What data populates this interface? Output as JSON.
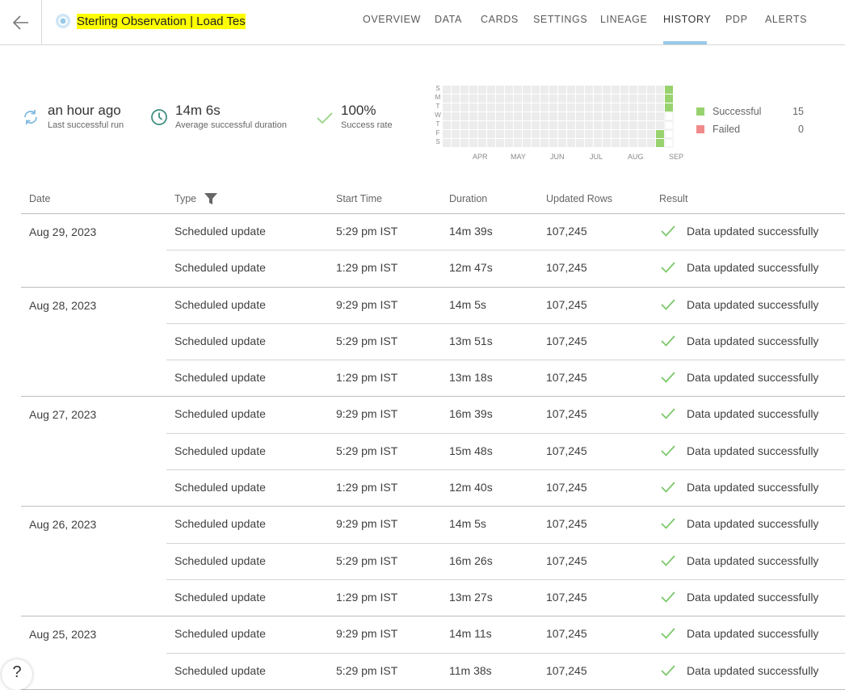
{
  "header": {
    "title": "Sterling Observation | Load Tes",
    "tabs": [
      "OVERVIEW",
      "DATA",
      "CARDS",
      "SETTINGS",
      "LINEAGE",
      "HISTORY",
      "PDP",
      "ALERTS"
    ],
    "active_tab": "HISTORY"
  },
  "stats": {
    "last_run": {
      "value": "an hour ago",
      "label": "Last successful run"
    },
    "avg_duration": {
      "value": "14m 6s",
      "label": "Average successful duration"
    },
    "success_rate": {
      "value": "100%",
      "label": "Success rate"
    }
  },
  "heatmap": {
    "days": [
      "S",
      "M",
      "T",
      "W",
      "T",
      "F",
      "S"
    ],
    "months": [
      "APR",
      "MAY",
      "JUN",
      "JUL",
      "AUG",
      "SEP"
    ],
    "legend": [
      {
        "name": "Successful",
        "count": "15",
        "color": "#98d26f"
      },
      {
        "name": "Failed",
        "count": "0",
        "color": "#f08a8a"
      }
    ]
  },
  "table": {
    "headers": {
      "date": "Date",
      "type": "Type",
      "start": "Start Time",
      "duration": "Duration",
      "rows": "Updated Rows",
      "result": "Result"
    },
    "groups": [
      {
        "date": "Aug 29, 2023",
        "rows": [
          {
            "type": "Scheduled update",
            "start": "5:29 pm IST",
            "duration": "14m 39s",
            "rows": "107,245",
            "result": "Data updated successfully"
          },
          {
            "type": "Scheduled update",
            "start": "1:29 pm IST",
            "duration": "12m 47s",
            "rows": "107,245",
            "result": "Data updated successfully"
          }
        ]
      },
      {
        "date": "Aug 28, 2023",
        "rows": [
          {
            "type": "Scheduled update",
            "start": "9:29 pm IST",
            "duration": "14m 5s",
            "rows": "107,245",
            "result": "Data updated successfully"
          },
          {
            "type": "Scheduled update",
            "start": "5:29 pm IST",
            "duration": "13m 51s",
            "rows": "107,245",
            "result": "Data updated successfully"
          },
          {
            "type": "Scheduled update",
            "start": "1:29 pm IST",
            "duration": "13m 18s",
            "rows": "107,245",
            "result": "Data updated successfully"
          }
        ]
      },
      {
        "date": "Aug 27, 2023",
        "rows": [
          {
            "type": "Scheduled update",
            "start": "9:29 pm IST",
            "duration": "16m 39s",
            "rows": "107,245",
            "result": "Data updated successfully"
          },
          {
            "type": "Scheduled update",
            "start": "5:29 pm IST",
            "duration": "15m 48s",
            "rows": "107,245",
            "result": "Data updated successfully"
          },
          {
            "type": "Scheduled update",
            "start": "1:29 pm IST",
            "duration": "12m 40s",
            "rows": "107,245",
            "result": "Data updated successfully"
          }
        ]
      },
      {
        "date": "Aug 26, 2023",
        "rows": [
          {
            "type": "Scheduled update",
            "start": "9:29 pm IST",
            "duration": "14m 5s",
            "rows": "107,245",
            "result": "Data updated successfully"
          },
          {
            "type": "Scheduled update",
            "start": "5:29 pm IST",
            "duration": "16m 26s",
            "rows": "107,245",
            "result": "Data updated successfully"
          },
          {
            "type": "Scheduled update",
            "start": "1:29 pm IST",
            "duration": "13m 27s",
            "rows": "107,245",
            "result": "Data updated successfully"
          }
        ]
      },
      {
        "date": "Aug 25, 2023",
        "rows": [
          {
            "type": "Scheduled update",
            "start": "9:29 pm IST",
            "duration": "14m 11s",
            "rows": "107,245",
            "result": "Data updated successfully"
          },
          {
            "type": "Scheduled update",
            "start": "5:29 pm IST",
            "duration": "11m 38s",
            "rows": "107,245",
            "result": "Data updated successfully"
          }
        ]
      }
    ]
  },
  "help": {
    "label": "?"
  },
  "colors": {
    "accent": "#99c9e8",
    "success": "#98d26f",
    "check": "#7cc86a",
    "highlight": "#ffff00"
  }
}
